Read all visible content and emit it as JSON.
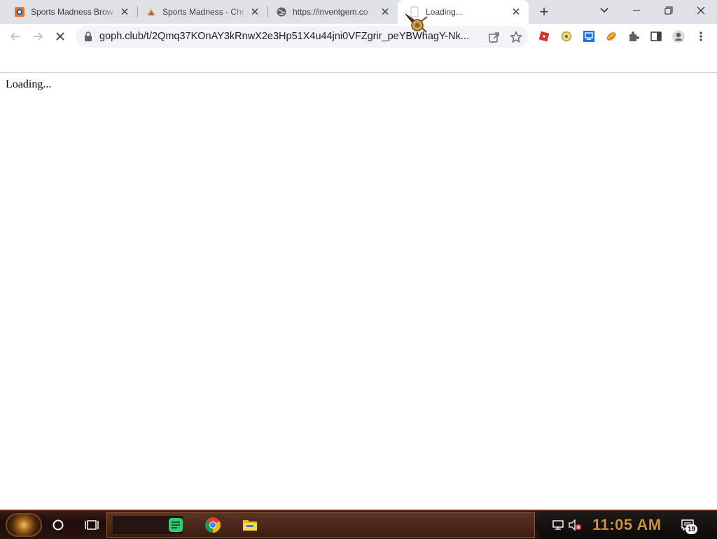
{
  "browser": {
    "tabs": [
      {
        "title": "Sports Madness Brow",
        "favicon": "sports-madness-icon",
        "active": false
      },
      {
        "title": "Sports Madness - Chr",
        "favicon": "chrome-store-rainbow-icon",
        "active": false
      },
      {
        "title": "https://inventgem.co",
        "favicon": "globe-icon",
        "active": false
      },
      {
        "title": "Loading...",
        "favicon": "blank-page-icon",
        "active": true
      }
    ],
    "new_tab_symbol": "+",
    "url": "goph.club/t/2Qmq37KOnAY3kRnwX2e3Hp51X4u44jni0VFZgrir_peYBWhagY-Nk...",
    "extensions": [
      "roblox-icon",
      "coin-icon",
      "monitor-icon",
      "candy-icon",
      "puzzle-icon",
      "sidepanel-icon",
      "profile-icon",
      "kebab-menu-icon"
    ]
  },
  "page": {
    "text": "Loading..."
  },
  "taskbar": {
    "clock": "11:05 AM",
    "notification_count": "19",
    "pinned": [
      "cortana-icon",
      "task-view-icon",
      "notes-app-icon",
      "chrome-icon",
      "file-explorer-icon"
    ],
    "tray": [
      "network-icon",
      "volume-muted-icon",
      "action-center-icon"
    ]
  },
  "colors": {
    "tabstrip": "#dee1e6",
    "omnibox": "#f1f3f4",
    "clock": "#c8923e",
    "taskbar": "#2a120c"
  }
}
